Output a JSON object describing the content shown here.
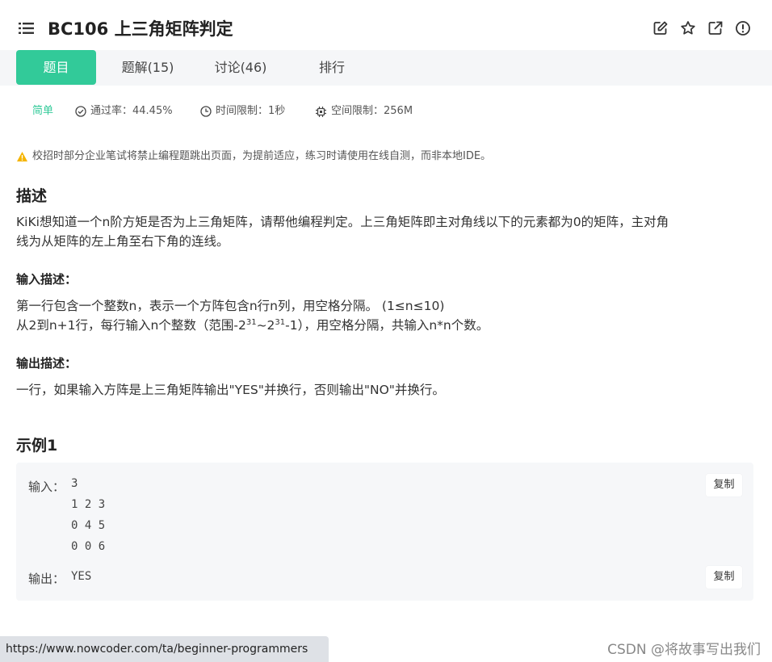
{
  "header": {
    "title": "BC106  上三角矩阵判定",
    "icons": [
      "list-icon",
      "edit-icon",
      "star-icon",
      "share-icon",
      "info-icon"
    ]
  },
  "tabs": [
    {
      "label": "题目",
      "active": true
    },
    {
      "label": "题解(15)",
      "active": false
    },
    {
      "label": "讨论(46)",
      "active": false
    },
    {
      "label": "排行",
      "active": false
    }
  ],
  "meta": {
    "difficulty": "简单",
    "pass_rate": "通过率：44.45%",
    "time_limit": "时间限制：1秒",
    "space_limit": "空间限制：256M"
  },
  "notice": "校招时部分企业笔试将禁止编程题跳出页面，为提前适应，练习时请使用在线自测，而非本地IDE。",
  "description": {
    "heading": "描述",
    "line1": "KiKi想知道一个n阶方矩是否为上三角矩阵，请帮他编程判定。上三角矩阵即主对角线以下的元素都为0的矩阵，主对角",
    "line2": "线为从矩阵的左上角至右下角的连线。"
  },
  "input_desc": {
    "heading": "输入描述：",
    "line1": "第一行包含一个整数n，表示一个方阵包含n行n列，用空格分隔。 (1≤n≤10)",
    "line2_a": "从2到n+1行，每行输入n个整数（范围-2",
    "line2_sup1": "31",
    "line2_b": "~2",
    "line2_sup2": "31",
    "line2_c": "-1），用空格分隔，共输入n*n个数。"
  },
  "output_desc": {
    "heading": "输出描述：",
    "line1": "一行，如果输入方阵是上三角矩阵输出\"YES\"并换行，否则输出\"NO\"并换行。"
  },
  "example": {
    "heading": "示例1",
    "input_label": "输入：",
    "input_text": "3\n1 2 3\n0 4 5\n0 0 6",
    "output_label": "输出：",
    "output_text": "YES",
    "copy_label": "复制"
  },
  "status_url": "https://www.nowcoder.com/ta/beginner-programmers",
  "watermark": "CSDN @将故事写出我们",
  "colors": {
    "accent": "#32ca99",
    "tabbar_bg": "#f5f6f8",
    "example_bg": "#f6f7f9"
  }
}
